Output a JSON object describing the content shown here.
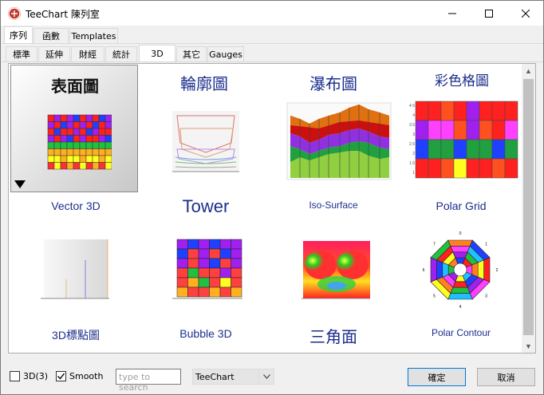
{
  "window": {
    "title": "TeeChart 陳列室"
  },
  "main_tabs": [
    {
      "label": "序列",
      "active": true
    },
    {
      "label": "函數",
      "active": false
    },
    {
      "label": "Templates",
      "active": false
    }
  ],
  "sub_tabs": [
    {
      "label": "標準",
      "active": false
    },
    {
      "label": "延伸",
      "active": false
    },
    {
      "label": "財經",
      "active": false
    },
    {
      "label": "統計",
      "active": false
    },
    {
      "label": "3D",
      "active": true
    },
    {
      "label": "其它",
      "active": false
    },
    {
      "label": "Gauges",
      "active": false
    }
  ],
  "gallery": {
    "row1_labels": [
      "表面圖",
      "輪廓圖",
      "瀑布圖",
      "彩色格圖"
    ],
    "row1_captions": [
      "Vector 3D",
      "Tower",
      "Iso-Surface",
      "Polar Grid"
    ],
    "row2_captions": [
      "3D標點圖",
      "Bubble 3D",
      "三角面",
      "Polar Contour"
    ]
  },
  "polar_grid_ticks": [
    "4.5",
    "4",
    "3.5",
    "3",
    "2.5",
    "2",
    "1.5",
    "1"
  ],
  "polar_contour_ticks": [
    "0",
    "1",
    "2",
    "3",
    "4",
    "5",
    "6",
    "7"
  ],
  "footer": {
    "chk_3d_label": "3D(3)",
    "chk_3d_checked": false,
    "chk_smooth_label": "Smooth",
    "chk_smooth_checked": true,
    "search_placeholder": "type to search",
    "combo_value": "TeeChart",
    "ok_label": "確定",
    "cancel_label": "取消"
  },
  "colors": {
    "label_blue": "#1c2e8c",
    "focus_blue": "#0078d7",
    "app_icon_red": "#c0392b"
  }
}
